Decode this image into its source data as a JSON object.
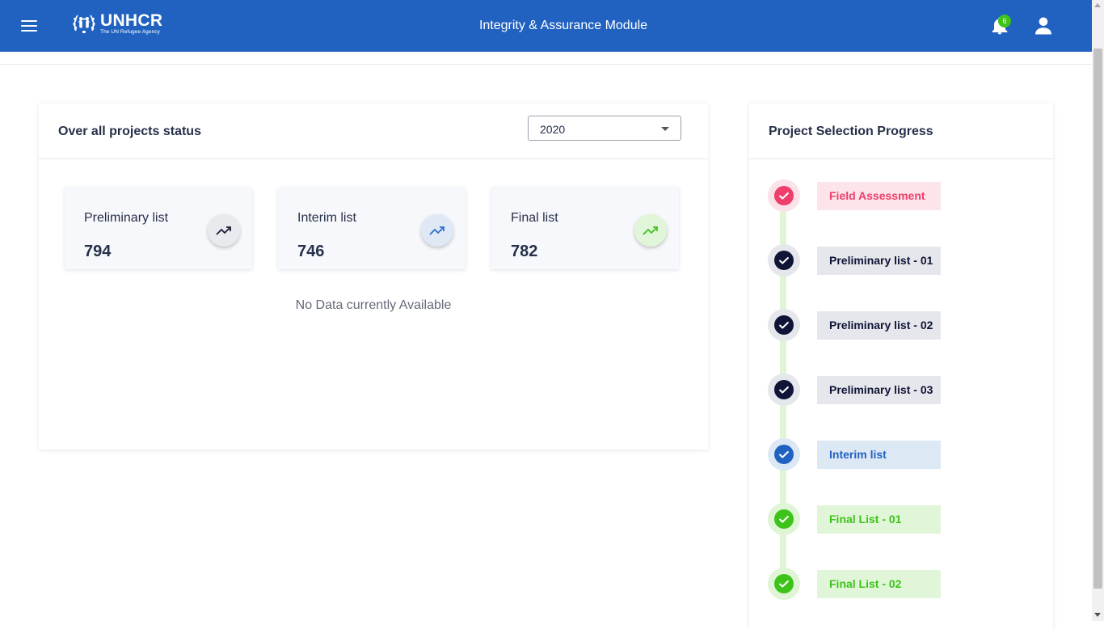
{
  "header": {
    "logo_main": "UNHCR",
    "logo_sub": "The UN Refugee Agency",
    "title": "Integrity & Assurance Module",
    "notification_count": "6",
    "menu_icon": "hamburger-icon",
    "bell_icon": "bell-icon",
    "user_icon": "user-icon"
  },
  "status_card": {
    "title": "Over all projects status",
    "year_select": {
      "selected": "2020"
    },
    "stats": [
      {
        "label": "Preliminary list",
        "value": "794",
        "icon": "trending-up-icon",
        "color": "#1a1f36",
        "bg": "#e9eaee"
      },
      {
        "label": "Interim list",
        "value": "746",
        "icon": "trending-up-icon",
        "color": "#2e6fcf",
        "bg": "#dfe8f5"
      },
      {
        "label": "Final list",
        "value": "782",
        "icon": "trending-up-icon",
        "color": "#3ec31a",
        "bg": "#e1f5d9"
      }
    ],
    "empty_message": "No Data currently Available"
  },
  "progress_card": {
    "title": "Project Selection Progress",
    "steps": [
      {
        "label": "Field Assessment",
        "color": "#ee3f6b",
        "chip_bg": "#fde3ea",
        "ring": "#fbe2e8"
      },
      {
        "label": "Preliminary list - 01",
        "color": "#101436",
        "chip_bg": "#e6e7ec",
        "ring": "#e6e7ec"
      },
      {
        "label": "Preliminary list - 02",
        "color": "#101436",
        "chip_bg": "#e6e7ec",
        "ring": "#e6e7ec"
      },
      {
        "label": "Preliminary list - 03",
        "color": "#101436",
        "chip_bg": "#e6e7ec",
        "ring": "#e6e7ec"
      },
      {
        "label": "Interim list",
        "color": "#2162c1",
        "chip_bg": "#dde8f5",
        "ring": "#dde8f5"
      },
      {
        "label": "Final List - 01",
        "color": "#3ec31a",
        "chip_bg": "#e1f5d9",
        "ring": "#dff5d6"
      },
      {
        "label": "Final List - 02",
        "color": "#3ec31a",
        "chip_bg": "#e1f5d9",
        "ring": "#dff5d6"
      }
    ]
  },
  "colors": {
    "header_bg": "#2162c1",
    "text_dark": "#27304a",
    "badge": "#3ec31a"
  }
}
